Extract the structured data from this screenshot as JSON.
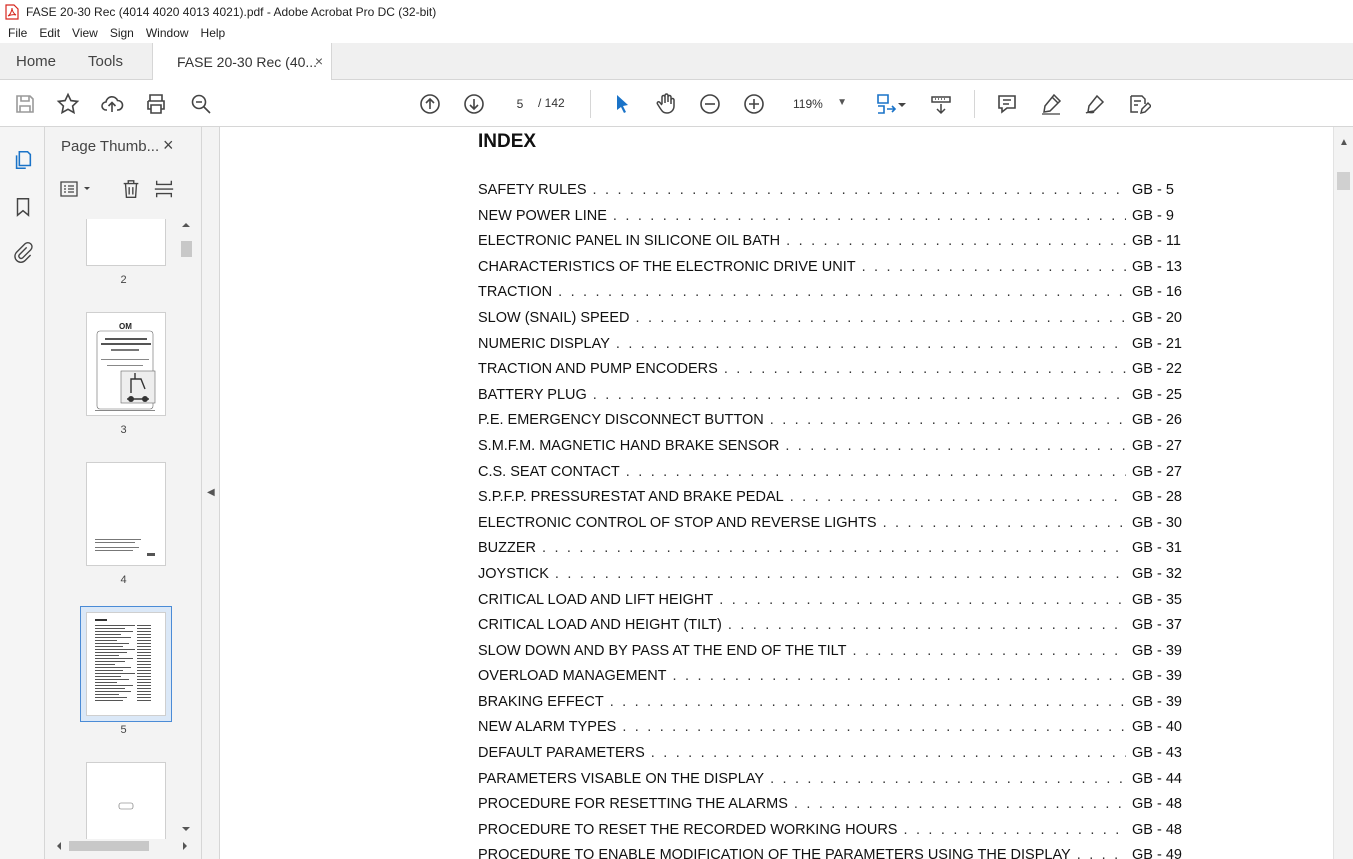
{
  "window": {
    "title": "FASE 20-30 Rec (4014 4020 4013 4021).pdf - Adobe Acrobat Pro DC (32-bit)"
  },
  "menu": [
    "File",
    "Edit",
    "View",
    "Sign",
    "Window",
    "Help"
  ],
  "tabs": {
    "home": "Home",
    "tools": "Tools",
    "doc": "FASE 20-30 Rec (40...",
    "close": "×"
  },
  "toolbar": {
    "page_current": "5",
    "page_total": "/ 142",
    "zoom": "119%",
    "icons": [
      "save-icon",
      "star-icon",
      "upload-icon",
      "print-icon",
      "search-zoom-icon",
      "page-up-icon",
      "page-down-icon",
      "select-cursor-icon",
      "hand-icon",
      "zoom-out-icon",
      "zoom-in-icon",
      "fit-page-icon",
      "scroll-mode-icon",
      "comment-icon",
      "highlight-icon",
      "sign-icon",
      "edit-sign-icon"
    ]
  },
  "thumbnails_panel": {
    "title": "Page Thumb...",
    "close": "×",
    "pages": [
      "2",
      "3",
      "4",
      "5"
    ],
    "selected": "5"
  },
  "document": {
    "title": "INDEX",
    "entries": [
      {
        "title": "SAFETY RULES",
        "page": "GB - 5"
      },
      {
        "title": "NEW POWER LINE",
        "page": "GB - 9"
      },
      {
        "title": "ELECTRONIC PANEL IN SILICONE OIL BATH",
        "page": "GB - 11"
      },
      {
        "title": "CHARACTERISTICS OF THE ELECTRONIC DRIVE UNIT",
        "page": "GB - 13"
      },
      {
        "title": "TRACTION",
        "page": "GB - 16"
      },
      {
        "title": "SLOW (SNAIL) SPEED",
        "page": "GB - 20"
      },
      {
        "title": "NUMERIC DISPLAY",
        "page": "GB - 21"
      },
      {
        "title": "TRACTION AND PUMP ENCODERS",
        "page": "GB - 22"
      },
      {
        "title": "BATTERY PLUG",
        "page": "GB - 25"
      },
      {
        "title": "P.E. EMERGENCY DISCONNECT BUTTON",
        "page": "GB - 26"
      },
      {
        "title": "S.M.F.M. MAGNETIC HAND BRAKE SENSOR",
        "page": "GB - 27"
      },
      {
        "title": "C.S. SEAT CONTACT",
        "page": "GB - 27"
      },
      {
        "title": "S.P.F.P. PRESSURESTAT AND BRAKE PEDAL",
        "page": "GB - 28"
      },
      {
        "title": "ELECTRONIC CONTROL OF STOP AND REVERSE LIGHTS",
        "page": "GB - 30"
      },
      {
        "title": "BUZZER",
        "page": "GB - 31"
      },
      {
        "title": "JOYSTICK",
        "page": "GB - 32"
      },
      {
        "title": "CRITICAL LOAD AND LIFT HEIGHT",
        "page": "GB - 35"
      },
      {
        "title": "CRITICAL LOAD AND HEIGHT (TILT)",
        "page": "GB - 37"
      },
      {
        "title": "SLOW DOWN AND BY PASS AT THE END OF THE TILT",
        "page": "GB - 39"
      },
      {
        "title": "OVERLOAD MANAGEMENT",
        "page": "GB - 39"
      },
      {
        "title": "BRAKING EFFECT",
        "page": "GB - 39"
      },
      {
        "title": "NEW ALARM TYPES",
        "page": "GB - 40"
      },
      {
        "title": "DEFAULT PARAMETERS",
        "page": "GB - 43"
      },
      {
        "title": "PARAMETERS VISABLE ON THE DISPLAY",
        "page": "GB - 44"
      },
      {
        "title": "PROCEDURE FOR RESETTING THE ALARMS",
        "page": "GB - 48"
      },
      {
        "title": "PROCEDURE TO RESET THE RECORDED WORKING HOURS",
        "page": "GB - 48"
      },
      {
        "title": "PROCEDURE TO ENABLE MODIFICATION OF THE PARAMETERS USING THE DISPLAY",
        "page": "GB - 49"
      }
    ]
  },
  "colors": {
    "accent": "#1a73c8",
    "toolbar_bg": "#ffffff",
    "panel_bg": "#f3f3f3",
    "pdf_red": "#d7261d"
  }
}
